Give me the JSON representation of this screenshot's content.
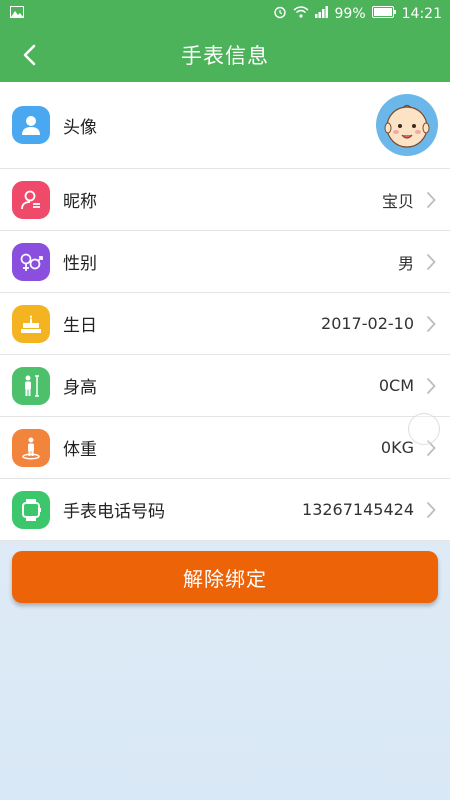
{
  "status": {
    "battery": "99%",
    "time": "14:21"
  },
  "header": {
    "title": "手表信息"
  },
  "rows": [
    {
      "label": "头像",
      "value": ""
    },
    {
      "label": "昵称",
      "value": "宝贝"
    },
    {
      "label": "性别",
      "value": "男"
    },
    {
      "label": "生日",
      "value": "2017-02-10"
    },
    {
      "label": "身高",
      "value": "0CM"
    },
    {
      "label": "体重",
      "value": "0KG"
    },
    {
      "label": "手表电话号码",
      "value": "13267145424"
    }
  ],
  "unbind": {
    "label": "解除绑定"
  },
  "colors": {
    "header": "#4cb35a",
    "button": "#ec6308",
    "icon_avatar": "#4aa8f0",
    "icon_nickname": "#ef4a6a",
    "icon_gender": "#8b4fe0",
    "icon_birthday": "#f4b320",
    "icon_height": "#4cc06a",
    "icon_weight": "#f3843c",
    "icon_phone": "#3dc76d"
  }
}
